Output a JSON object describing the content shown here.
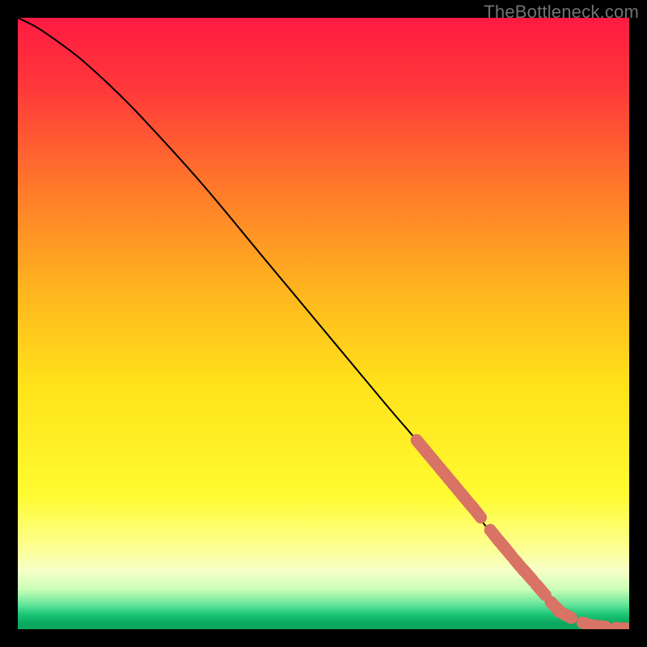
{
  "watermark": "TheBottleneck.com",
  "colors": {
    "background": "#000000",
    "curve": "#000000",
    "marker": "#d87365",
    "gradient_stops": [
      {
        "offset": 0.0,
        "color": "#ff1a42"
      },
      {
        "offset": 0.12,
        "color": "#ff3a3a"
      },
      {
        "offset": 0.28,
        "color": "#ff7a2a"
      },
      {
        "offset": 0.45,
        "color": "#ffb61e"
      },
      {
        "offset": 0.6,
        "color": "#ffe21a"
      },
      {
        "offset": 0.78,
        "color": "#fffb30"
      },
      {
        "offset": 0.86,
        "color": "#fdff8a"
      },
      {
        "offset": 0.905,
        "color": "#f6ffc8"
      },
      {
        "offset": 0.935,
        "color": "#c9ffb6"
      },
      {
        "offset": 0.96,
        "color": "#63e59a"
      },
      {
        "offset": 0.975,
        "color": "#1fc776"
      },
      {
        "offset": 0.99,
        "color": "#0aa85f"
      },
      {
        "offset": 1.0,
        "color": "#0aa85f"
      }
    ]
  },
  "chart_data": {
    "type": "line",
    "title": "",
    "xlabel": "",
    "ylabel": "",
    "xlim": [
      0,
      100
    ],
    "ylim": [
      0,
      100
    ],
    "series": [
      {
        "name": "curve",
        "x": [
          0,
          3,
          6,
          10,
          15,
          20,
          30,
          40,
          50,
          60,
          66,
          70,
          74,
          78,
          81,
          84,
          86,
          88,
          90,
          92,
          94,
          96,
          98,
          100
        ],
        "y": [
          100,
          98.5,
          96.5,
          93.5,
          89,
          84,
          73,
          61,
          49,
          37,
          30,
          25,
          20,
          15,
          11,
          7.5,
          5.3,
          3.6,
          2.2,
          1.2,
          0.6,
          0.25,
          0.1,
          0.05
        ]
      }
    ],
    "markers": {
      "name": "highlighted-points",
      "color": "#d87365",
      "x": [
        66,
        67.5,
        69,
        70.5,
        72,
        73.5,
        75,
        78,
        79,
        80,
        82,
        83.5,
        85.5,
        88,
        89.5,
        93.5,
        95,
        99,
        100
      ],
      "y": [
        30,
        28.2,
        26.4,
        24.6,
        22.8,
        21.0,
        19.2,
        15.3,
        14.1,
        12.9,
        10.5,
        8.8,
        6.5,
        3.6,
        2.4,
        0.7,
        0.5,
        0.1,
        0.1
      ]
    }
  }
}
